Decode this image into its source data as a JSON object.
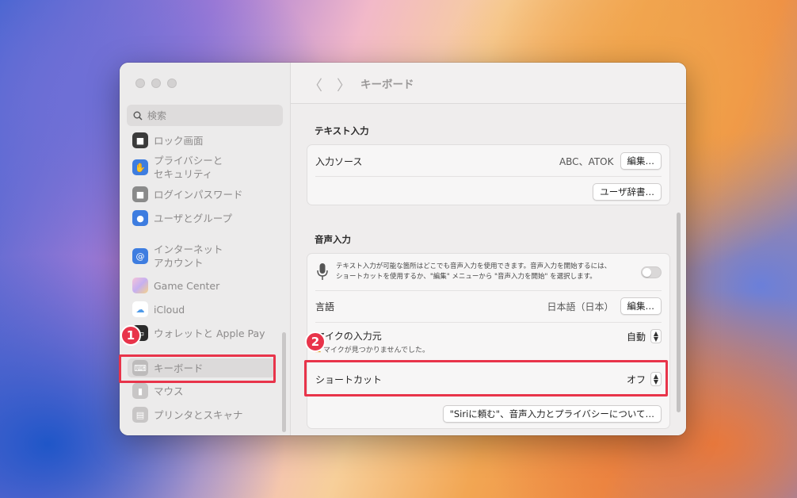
{
  "window": {
    "title": "キーボード"
  },
  "sidebar": {
    "search_placeholder": "検索",
    "items": [
      {
        "label": "ロック画面"
      },
      {
        "label": "プライバシーと",
        "label2": "セキュリティ"
      },
      {
        "label": "ログインパスワード"
      },
      {
        "label": "ユーザとグループ"
      },
      {
        "label": "インターネット",
        "label2": "アカウント"
      },
      {
        "label": "Game Center"
      },
      {
        "label": "iCloud"
      },
      {
        "label": "ウォレットと Apple Pay"
      },
      {
        "label": "キーボード"
      },
      {
        "label": "マウス"
      },
      {
        "label": "プリンタとスキャナ"
      }
    ]
  },
  "text_input": {
    "heading": "テキスト入力",
    "input_source_label": "入力ソース",
    "input_source_value": "ABC、ATOK",
    "edit_button": "編集…",
    "user_dict_button": "ユーザ辞書…"
  },
  "voice_input": {
    "heading": "音声入力",
    "description_line1": "テキスト入力が可能な箇所はどこでも音声入力を使用できます。音声入力を開始するには、",
    "description_line2": "ショートカットを使用するか、\"編集\" メニューから \"音声入力を開始\" を選択します。",
    "language_label": "言語",
    "language_value": "日本語（日本）",
    "language_edit_button": "編集…",
    "mic_label": "マイクの入力元",
    "mic_warning": "マイクが見つかりませんでした。",
    "mic_value": "自動",
    "shortcut_label": "ショートカット",
    "shortcut_value": "オフ",
    "siri_button": "\"Siriに頼む\"、音声入力とプライバシーについて…"
  },
  "annotations": {
    "badge1": "1",
    "badge2": "2"
  },
  "colors": {
    "highlight": "#e8344a"
  }
}
